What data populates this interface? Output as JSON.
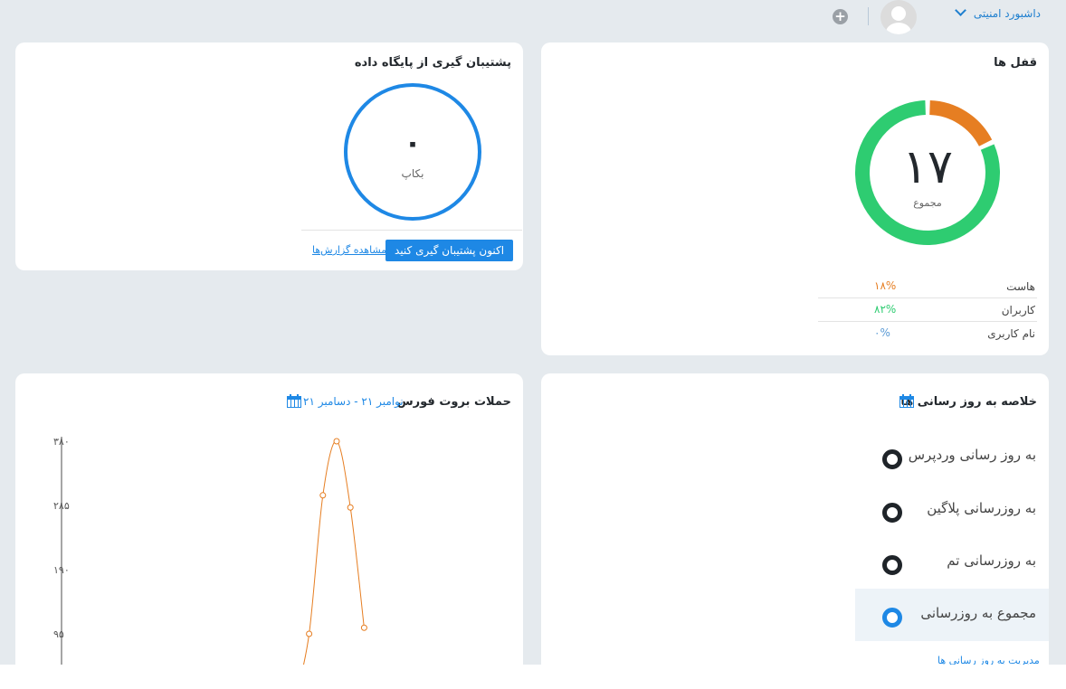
{
  "header": {
    "dashboard_label": "داشبورد امنیتی",
    "icons": [
      "chevron-down-icon",
      "user-avatar",
      "plus-circle-icon"
    ]
  },
  "locks": {
    "title": "قفل ها",
    "total": "۱۷",
    "total_label": "مجموع",
    "colors": {
      "hosts": "#e67e22",
      "users": "#2ecc71",
      "usernames": "#5b9bd5"
    },
    "stats": [
      {
        "label": "هاست",
        "value": "۱۸%",
        "fraction": 0.18,
        "color": "#e67e22"
      },
      {
        "label": "کاربران",
        "value": "۸۲%",
        "fraction": 0.82,
        "color": "#2ecc71"
      },
      {
        "label": "نام کاربری",
        "value": "۰%",
        "fraction": 0,
        "color": "#5b9bd5"
      }
    ]
  },
  "backup": {
    "title": "پشتیبان گیری از پایگاه داده",
    "count": "۰",
    "count_label": "بکاپ",
    "button_label": "اکنون پشتیبان گیری کنید",
    "reports_link": "مشاهده گزارش‌ها"
  },
  "updates": {
    "title": "خلاصه به روز رسانی ها",
    "items": [
      {
        "label": "به روز رسانی وردپرس",
        "active": false
      },
      {
        "label": "به روزرسانی پلاگین",
        "active": false
      },
      {
        "label": "به روزرسانی تم",
        "active": false
      },
      {
        "label": "مجموع به روزرسانی",
        "active": true
      }
    ],
    "manage_link": "مدیریت به روز رسانی ها"
  },
  "brute_force": {
    "title": "حملات بروت فورس",
    "date_range": "نوامبر ۲۱ - دسامبر ۲۱"
  },
  "chart_data": {
    "type": "line",
    "title": "حملات بروت فورس",
    "y_tick_labels": [
      "۳۸۰",
      "۲۸۵",
      "۱۹۰",
      "۹۵"
    ],
    "y_ticks": [
      380,
      285,
      190,
      95
    ],
    "ylim": [
      0,
      380
    ],
    "series": [
      {
        "color": "#e67e22",
        "points": [
          {
            "x": 17,
            "y": 0
          },
          {
            "x": 18,
            "y": 95
          },
          {
            "x": 19,
            "y": 300
          },
          {
            "x": 20,
            "y": 380
          },
          {
            "x": 21,
            "y": 282
          },
          {
            "x": 22,
            "y": 104
          }
        ]
      }
    ],
    "x_visible_range": [
      0,
      23
    ],
    "grid": false
  }
}
